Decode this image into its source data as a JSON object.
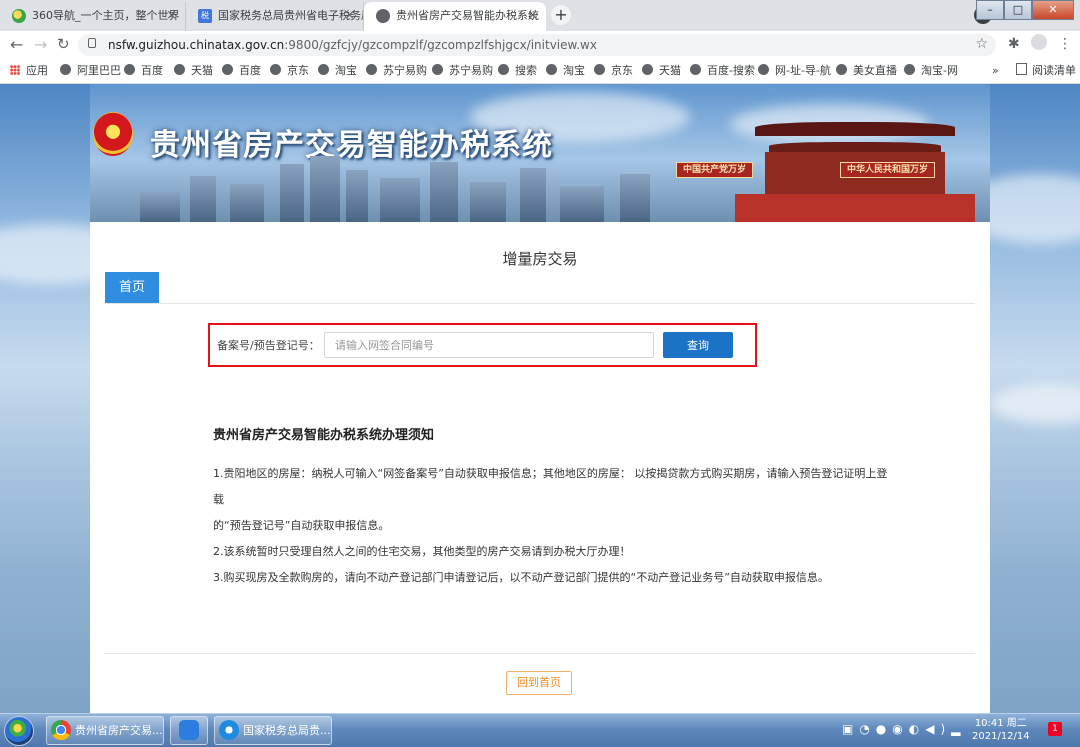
{
  "browser": {
    "tabs": [
      {
        "title": "360导航_一个主页，整个世界"
      },
      {
        "title": "国家税务总局贵州省电子税务局",
        "badge": "税"
      },
      {
        "title": "贵州省房产交易智能办税系统"
      }
    ],
    "tab_close": "×",
    "new_tab": "+",
    "url_domain": "nsfw.guizhou.chinatax.gov.cn",
    "url_path": ":9800/gzfcjy/gzcompzlf/gzcompzlfshjgcx/initview.wx",
    "bookmarks": [
      "应用",
      "阿里巴巴",
      "百度",
      "天猫",
      "百度",
      "京东",
      "淘宝",
      "苏宁易购",
      "苏宁易购",
      "搜索",
      "淘宝",
      "京东",
      "天猫",
      "百度-搜索",
      "网-址-导-航",
      "美女直播",
      "淘宝-网"
    ],
    "bookmarks_more": "»",
    "reading_list": "阅读清单"
  },
  "banner": {
    "title": "贵州省房产交易智能办税系统",
    "sign_left": "中国共产党万岁",
    "sign_right": "中华人民共和国万岁"
  },
  "main": {
    "heading": "增量房交易",
    "tab_home": "首页",
    "search": {
      "label": "备案号/预告登记号：",
      "placeholder": "请输入网签合同编号",
      "value": "",
      "button": "查询"
    },
    "notice": {
      "title": "贵州省房产交易智能办税系统办理须知",
      "items": [
        "1.贵阳地区的房屋：纳税人可输入“网签备案号”自动获取申报信息；其他地区的房屋： 以按揭贷款方式购买期房，请输入预告登记证明上登载",
        "的“预告登记号”自动获取申报信息。",
        "2.该系统暂时只受理自然人之间的住宅交易，其他类型的房产交易请到办税大厅办理！",
        "3.购买现房及全款购房的，请向不动产登记部门申请登记后，以不动产登记部门提供的“不动产登记业务号”自动获取申报信息。"
      ]
    },
    "back_button": "回到首页"
  },
  "taskbar": {
    "tasks": [
      "贵州省房产交易...",
      "国家税务总局贵..."
    ],
    "time": "10:41 周二",
    "date": "2021/12/14",
    "notif_count": "1"
  },
  "colors": {
    "accent": "#2f8ee0",
    "button": "#1a73c7",
    "highlight": "#e0141a",
    "back_button": "#f08a20"
  }
}
